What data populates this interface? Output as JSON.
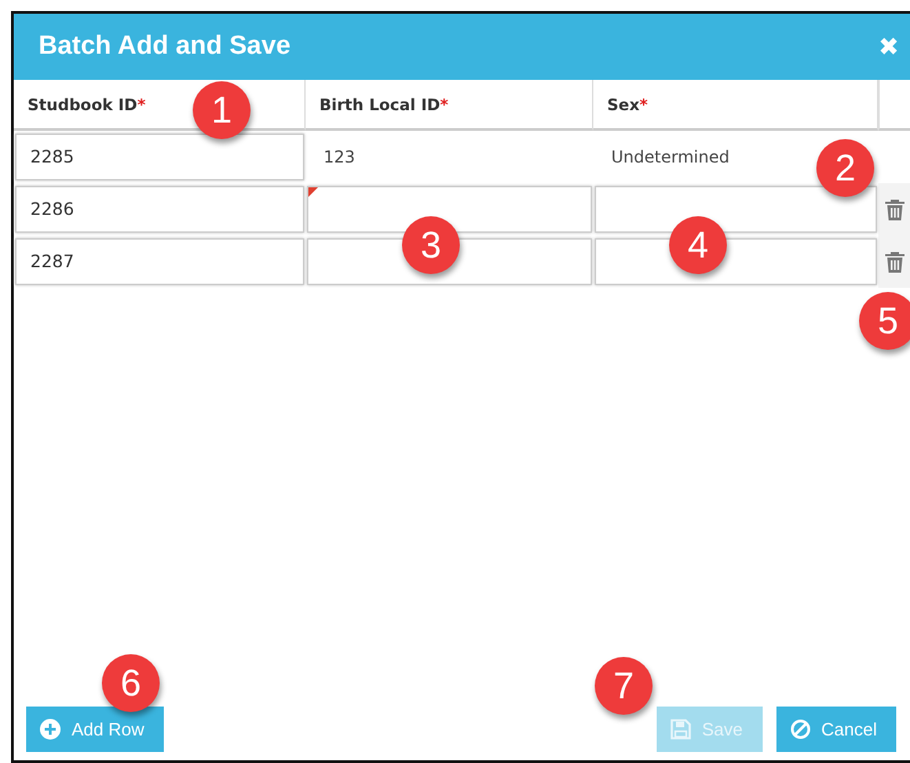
{
  "dialog": {
    "title": "Batch Add and Save",
    "close": "✖"
  },
  "columns": [
    {
      "label": "Studbook ID",
      "required_mark": "*"
    },
    {
      "label": "Birth Local ID",
      "required_mark": "*"
    },
    {
      "label": "Sex",
      "required_mark": "*"
    }
  ],
  "rows": [
    {
      "deletable": false,
      "cells": [
        {
          "kind": "input",
          "value": "2285",
          "flagged": false
        },
        {
          "kind": "text",
          "value": "123",
          "flagged": false
        },
        {
          "kind": "text",
          "value": "Undetermined",
          "flagged": false
        }
      ]
    },
    {
      "deletable": true,
      "cells": [
        {
          "kind": "input",
          "value": "2286",
          "flagged": false
        },
        {
          "kind": "input",
          "flagged": true
        },
        {
          "kind": "input",
          "flagged": false
        }
      ]
    },
    {
      "deletable": true,
      "cells": [
        {
          "kind": "input",
          "value": "2287",
          "flagged": false
        },
        {
          "kind": "input",
          "flagged": false
        },
        {
          "kind": "input",
          "flagged": false
        }
      ]
    }
  ],
  "buttons": [
    {
      "kind": "add",
      "label": "Add Row",
      "disabled": false
    },
    {
      "kind": "save",
      "label": "Save",
      "disabled": true
    },
    {
      "kind": "cancel",
      "label": "Cancel",
      "disabled": false
    }
  ],
  "callouts": [
    "1",
    "2",
    "3",
    "4",
    "5",
    "6",
    "7"
  ]
}
